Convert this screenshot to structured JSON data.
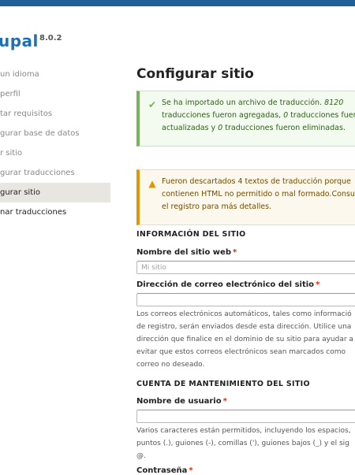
{
  "brand": {
    "name": "upal",
    "version": "8.0.2"
  },
  "steps": [
    {
      "label": "un idioma"
    },
    {
      "label": "perfil"
    },
    {
      "label": "tar requisitos"
    },
    {
      "label": "gurar base de datos"
    },
    {
      "label": "r sitio"
    },
    {
      "label": "gurar traducciones"
    },
    {
      "label": "gurar sitio"
    },
    {
      "label": "nar traducciones"
    }
  ],
  "main": {
    "title": "Configurar sitio",
    "status_message": {
      "part1": "Se ha importado un archivo de traducción. ",
      "count1": "8120",
      "part2": " traducciones fueron agregadas, ",
      "count2": "0",
      "part3": " traducciones fueron actualizadas y ",
      "count3": "0",
      "part4": " traducciones fueron eliminadas."
    },
    "warning_message": "Fueron descartados 4 textos de traducción porque contienen HTML no permitido o mal formado.Consulte el registro para más detalles.",
    "site_info": {
      "section_title": "INFORMACIÓN DEL SITIO",
      "site_name_label": "Nombre del sitio web",
      "site_name_placeholder": "Mi sitio",
      "email_label": "Dirección de correo electrónico del sitio",
      "email_value": "",
      "email_desc": [
        "Los correos electrónicos automáticos, tales como informació",
        "de registro, serán enviados desde esta dirección. Utilice una",
        "dirección que finalice en el dominio de su sitio para ayudar a",
        "evitar que estos correos electrónicos sean marcados como",
        "correo no deseado."
      ]
    },
    "account": {
      "section_title": "CUENTA DE MANTENIMIENTO DEL SITIO",
      "username_label": "Nombre de usuario",
      "username_value": "",
      "username_desc": [
        "Varios caracteres están permitidos, incluyendo los espacios,",
        "puntos (.), guiones (-), comillas ('), guiones bajos (_) y el sig",
        "@."
      ],
      "password_label": "Contraseña"
    },
    "required_mark": "*"
  },
  "colors": {
    "brand_blue": "#1e6fb5",
    "topbar": "#1e5f95",
    "status_green": "#77b259",
    "warning_orange": "#e09600",
    "required_red": "#e62600"
  }
}
